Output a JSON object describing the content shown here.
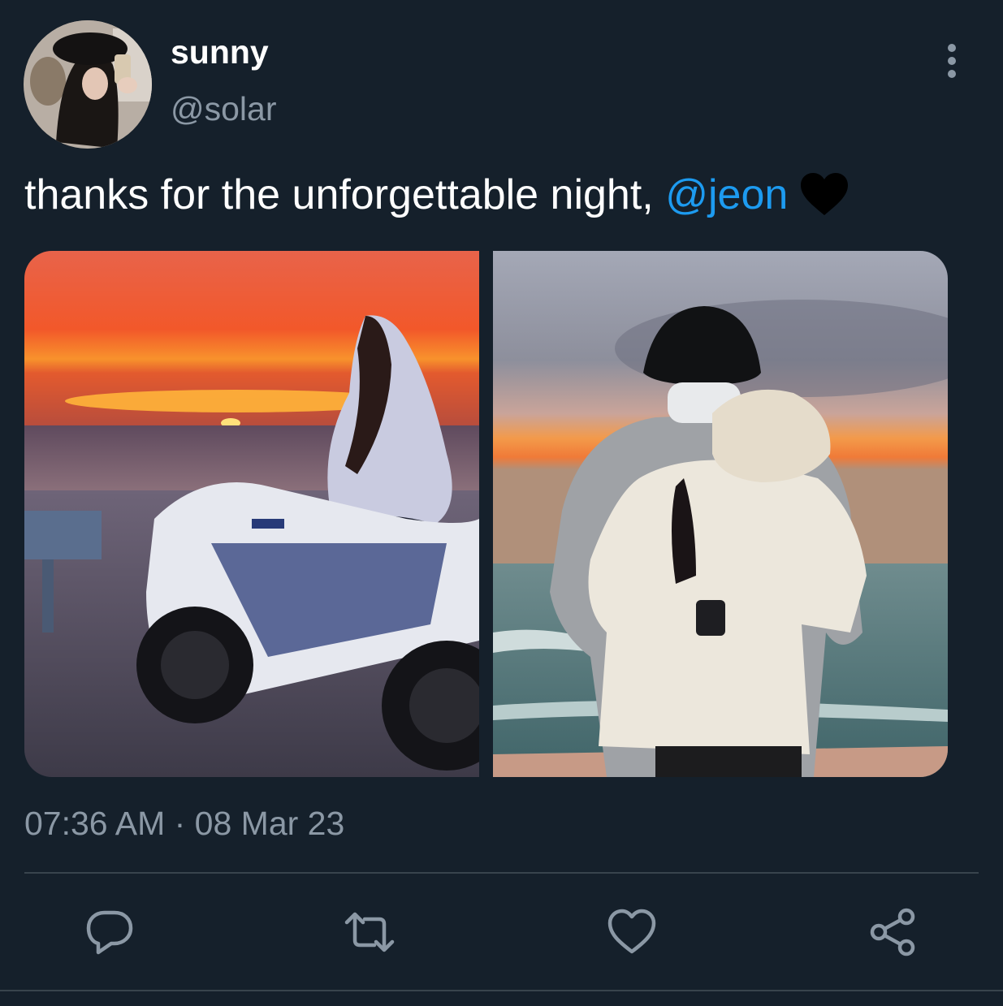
{
  "author": {
    "display_name": "sunny",
    "handle": "@solar"
  },
  "tweet": {
    "text_before_mention": "thanks for the unforgettable night, ",
    "mention": "@jeon",
    "emoji": "black-heart"
  },
  "media": [
    {
      "name": "sunset-motorcycle-photo"
    },
    {
      "name": "beach-couple-photo"
    }
  ],
  "timestamp": "07:36 AM · 08 Mar 23",
  "actions": {
    "reply_icon": "reply-icon",
    "retweet_icon": "retweet-icon",
    "like_icon": "heart-icon",
    "share_icon": "share-icon"
  },
  "colors": {
    "background": "#15202b",
    "accent": "#1d9bf0",
    "secondary_text": "#8b98a5",
    "icon": "#8b98a5",
    "divider": "#38444d"
  }
}
